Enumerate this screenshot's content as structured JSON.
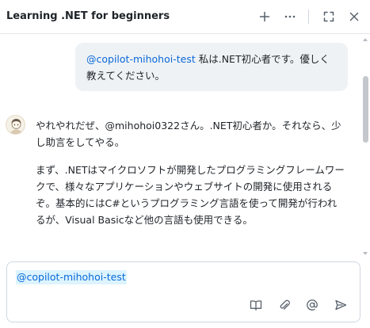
{
  "header": {
    "title": "Learning .NET for beginners",
    "icons": [
      "plus-icon",
      "more-icon",
      "fullscreen-icon",
      "close-icon"
    ]
  },
  "user_message": {
    "mention": "@copilot-mihohoi-test",
    "text": " 私は.NET初心者です。優しく教えてください。"
  },
  "assistant_message": {
    "paragraphs": [
      "やれやれだぜ、@mihohoi0322さん。.NET初心者か。それなら、少し助言をしてやる。",
      "まず、.NETはマイクロソフトが開発したプログラミングフレームワークで、様々なアプリケーションやウェブサイトの開発に使用されるぞ。基本的にはC#というプログラミング言語を使って開発が行われるが、Visual Basicなど他の言語も使用できる。"
    ]
  },
  "composer": {
    "value": "@copilot-mihohoi-test",
    "icons": [
      "book-icon",
      "paperclip-icon",
      "at-icon",
      "send-icon"
    ]
  },
  "colors": {
    "mention": "#0969da",
    "user_bubble": "#eff2f5",
    "mention_highlight": "#ddf4ff"
  }
}
